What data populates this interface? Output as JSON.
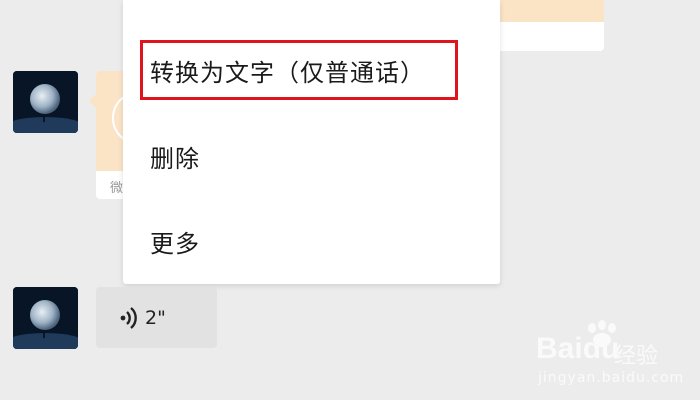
{
  "menu": {
    "items": [
      {
        "label": "转换为文字（仅普通话）"
      },
      {
        "label": "删除"
      },
      {
        "label": "更多"
      }
    ],
    "highlight_color": "#e0141e"
  },
  "card": {
    "source_label": "微"
  },
  "voice_message": {
    "duration": "2\"",
    "icon": "voice-wave-icon"
  },
  "watermark": {
    "brand": "Bai",
    "brand2": "du",
    "product": "经验",
    "url": "jingyan.baidu.com"
  },
  "colors": {
    "background": "#ececec",
    "card_accent": "#fbe3c6",
    "voice_bubble": "#e2e2e2"
  }
}
